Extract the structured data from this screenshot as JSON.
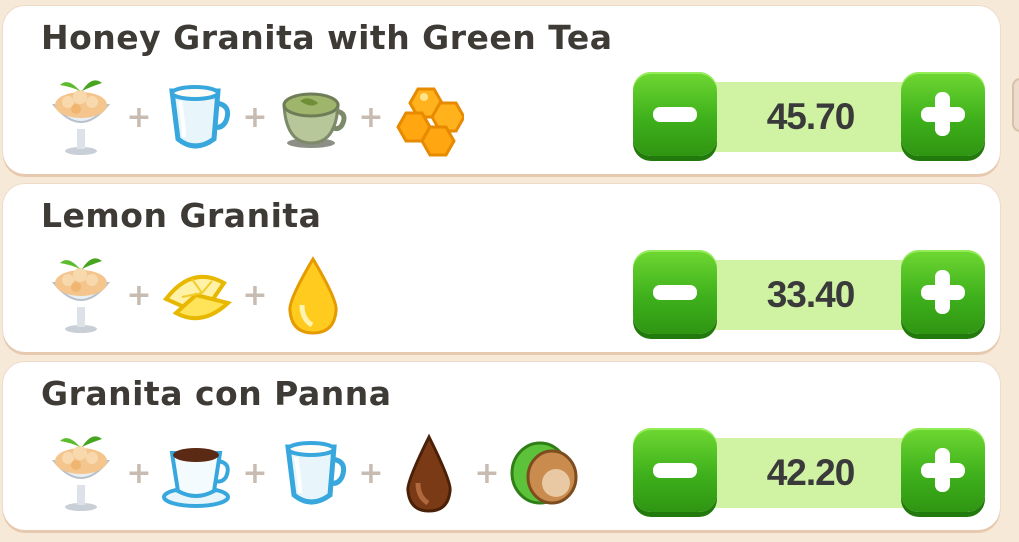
{
  "recipes": [
    {
      "name": "Honey Granita with Green Tea",
      "ingredients": [
        "granita-icon",
        "milk-jug-icon",
        "green-tea-icon",
        "honeycomb-icon"
      ],
      "value": "45.70"
    },
    {
      "name": "Lemon Granita",
      "ingredients": [
        "granita-icon",
        "lemon-slices-icon",
        "oil-drop-icon"
      ],
      "value": "33.40"
    },
    {
      "name": "Granita con Panna",
      "ingredients": [
        "granita-icon",
        "coffee-cup-icon",
        "milk-jug-icon",
        "chocolate-drop-icon",
        "hazelnut-icon"
      ],
      "value": "42.20"
    }
  ],
  "plus_sign": "+",
  "colors": {
    "background": "#f7e9d8",
    "button_green": "#3fb11c",
    "value_bar": "#cff2a3"
  }
}
